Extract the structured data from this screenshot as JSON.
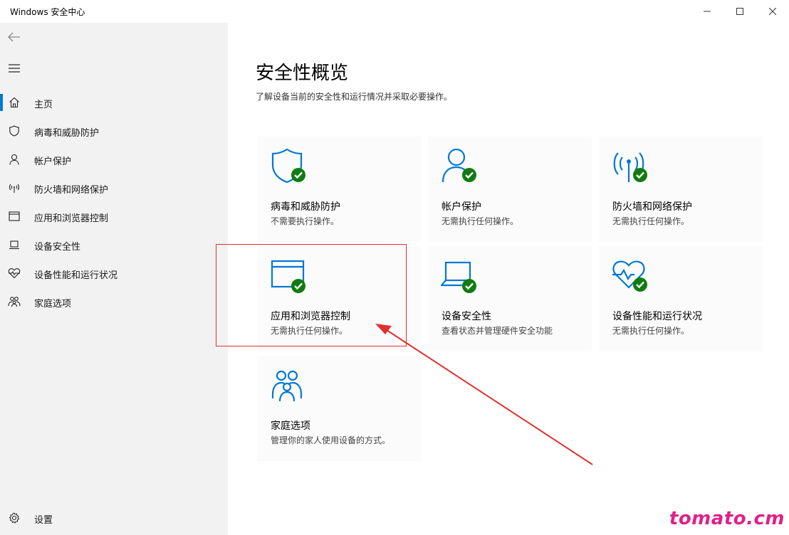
{
  "window": {
    "title": "Windows 安全中心"
  },
  "colors": {
    "accent": "#0078d4",
    "ok_green": "#107c10",
    "sidebar_bg": "#f2f2f2",
    "annotation_red": "#e03030",
    "watermark": "#e0208a"
  },
  "sidebar": {
    "items": [
      {
        "label": "主页",
        "icon": "home-icon",
        "active": true
      },
      {
        "label": "病毒和威胁防护",
        "icon": "shield-icon",
        "active": false
      },
      {
        "label": "帐户保护",
        "icon": "person-icon",
        "active": false
      },
      {
        "label": "防火墙和网络保护",
        "icon": "wifi-antenna-icon",
        "active": false
      },
      {
        "label": "应用和浏览器控制",
        "icon": "browser-window-icon",
        "active": false
      },
      {
        "label": "设备安全性",
        "icon": "laptop-icon",
        "active": false
      },
      {
        "label": "设备性能和运行状况",
        "icon": "heart-pulse-icon",
        "active": false
      },
      {
        "label": "家庭选项",
        "icon": "family-icon",
        "active": false
      }
    ],
    "settings_label": "设置"
  },
  "main": {
    "title": "安全性概览",
    "subtitle": "了解设备当前的安全性和运行情况并采取必要操作。",
    "tiles": [
      {
        "title": "病毒和威胁防护",
        "desc": "不需要执行操作。",
        "icon": "shield-check-icon"
      },
      {
        "title": "帐户保护",
        "desc": "无需执行任何操作。",
        "icon": "person-check-icon"
      },
      {
        "title": "防火墙和网络保护",
        "desc": "无需执行任何操作。",
        "icon": "antenna-check-icon"
      },
      {
        "title": "应用和浏览器控制",
        "desc": "无需执行任何操作。",
        "icon": "browser-check-icon"
      },
      {
        "title": "设备安全性",
        "desc": "查看状态并管理硬件安全功能",
        "icon": "laptop-check-icon"
      },
      {
        "title": "设备性能和运行状况",
        "desc": "无需执行任何操作。",
        "icon": "heart-check-icon"
      },
      {
        "title": "家庭选项",
        "desc": "管理你的家人使用设备的方式。",
        "icon": "family-icon"
      }
    ]
  },
  "watermark": "tomato.cm"
}
